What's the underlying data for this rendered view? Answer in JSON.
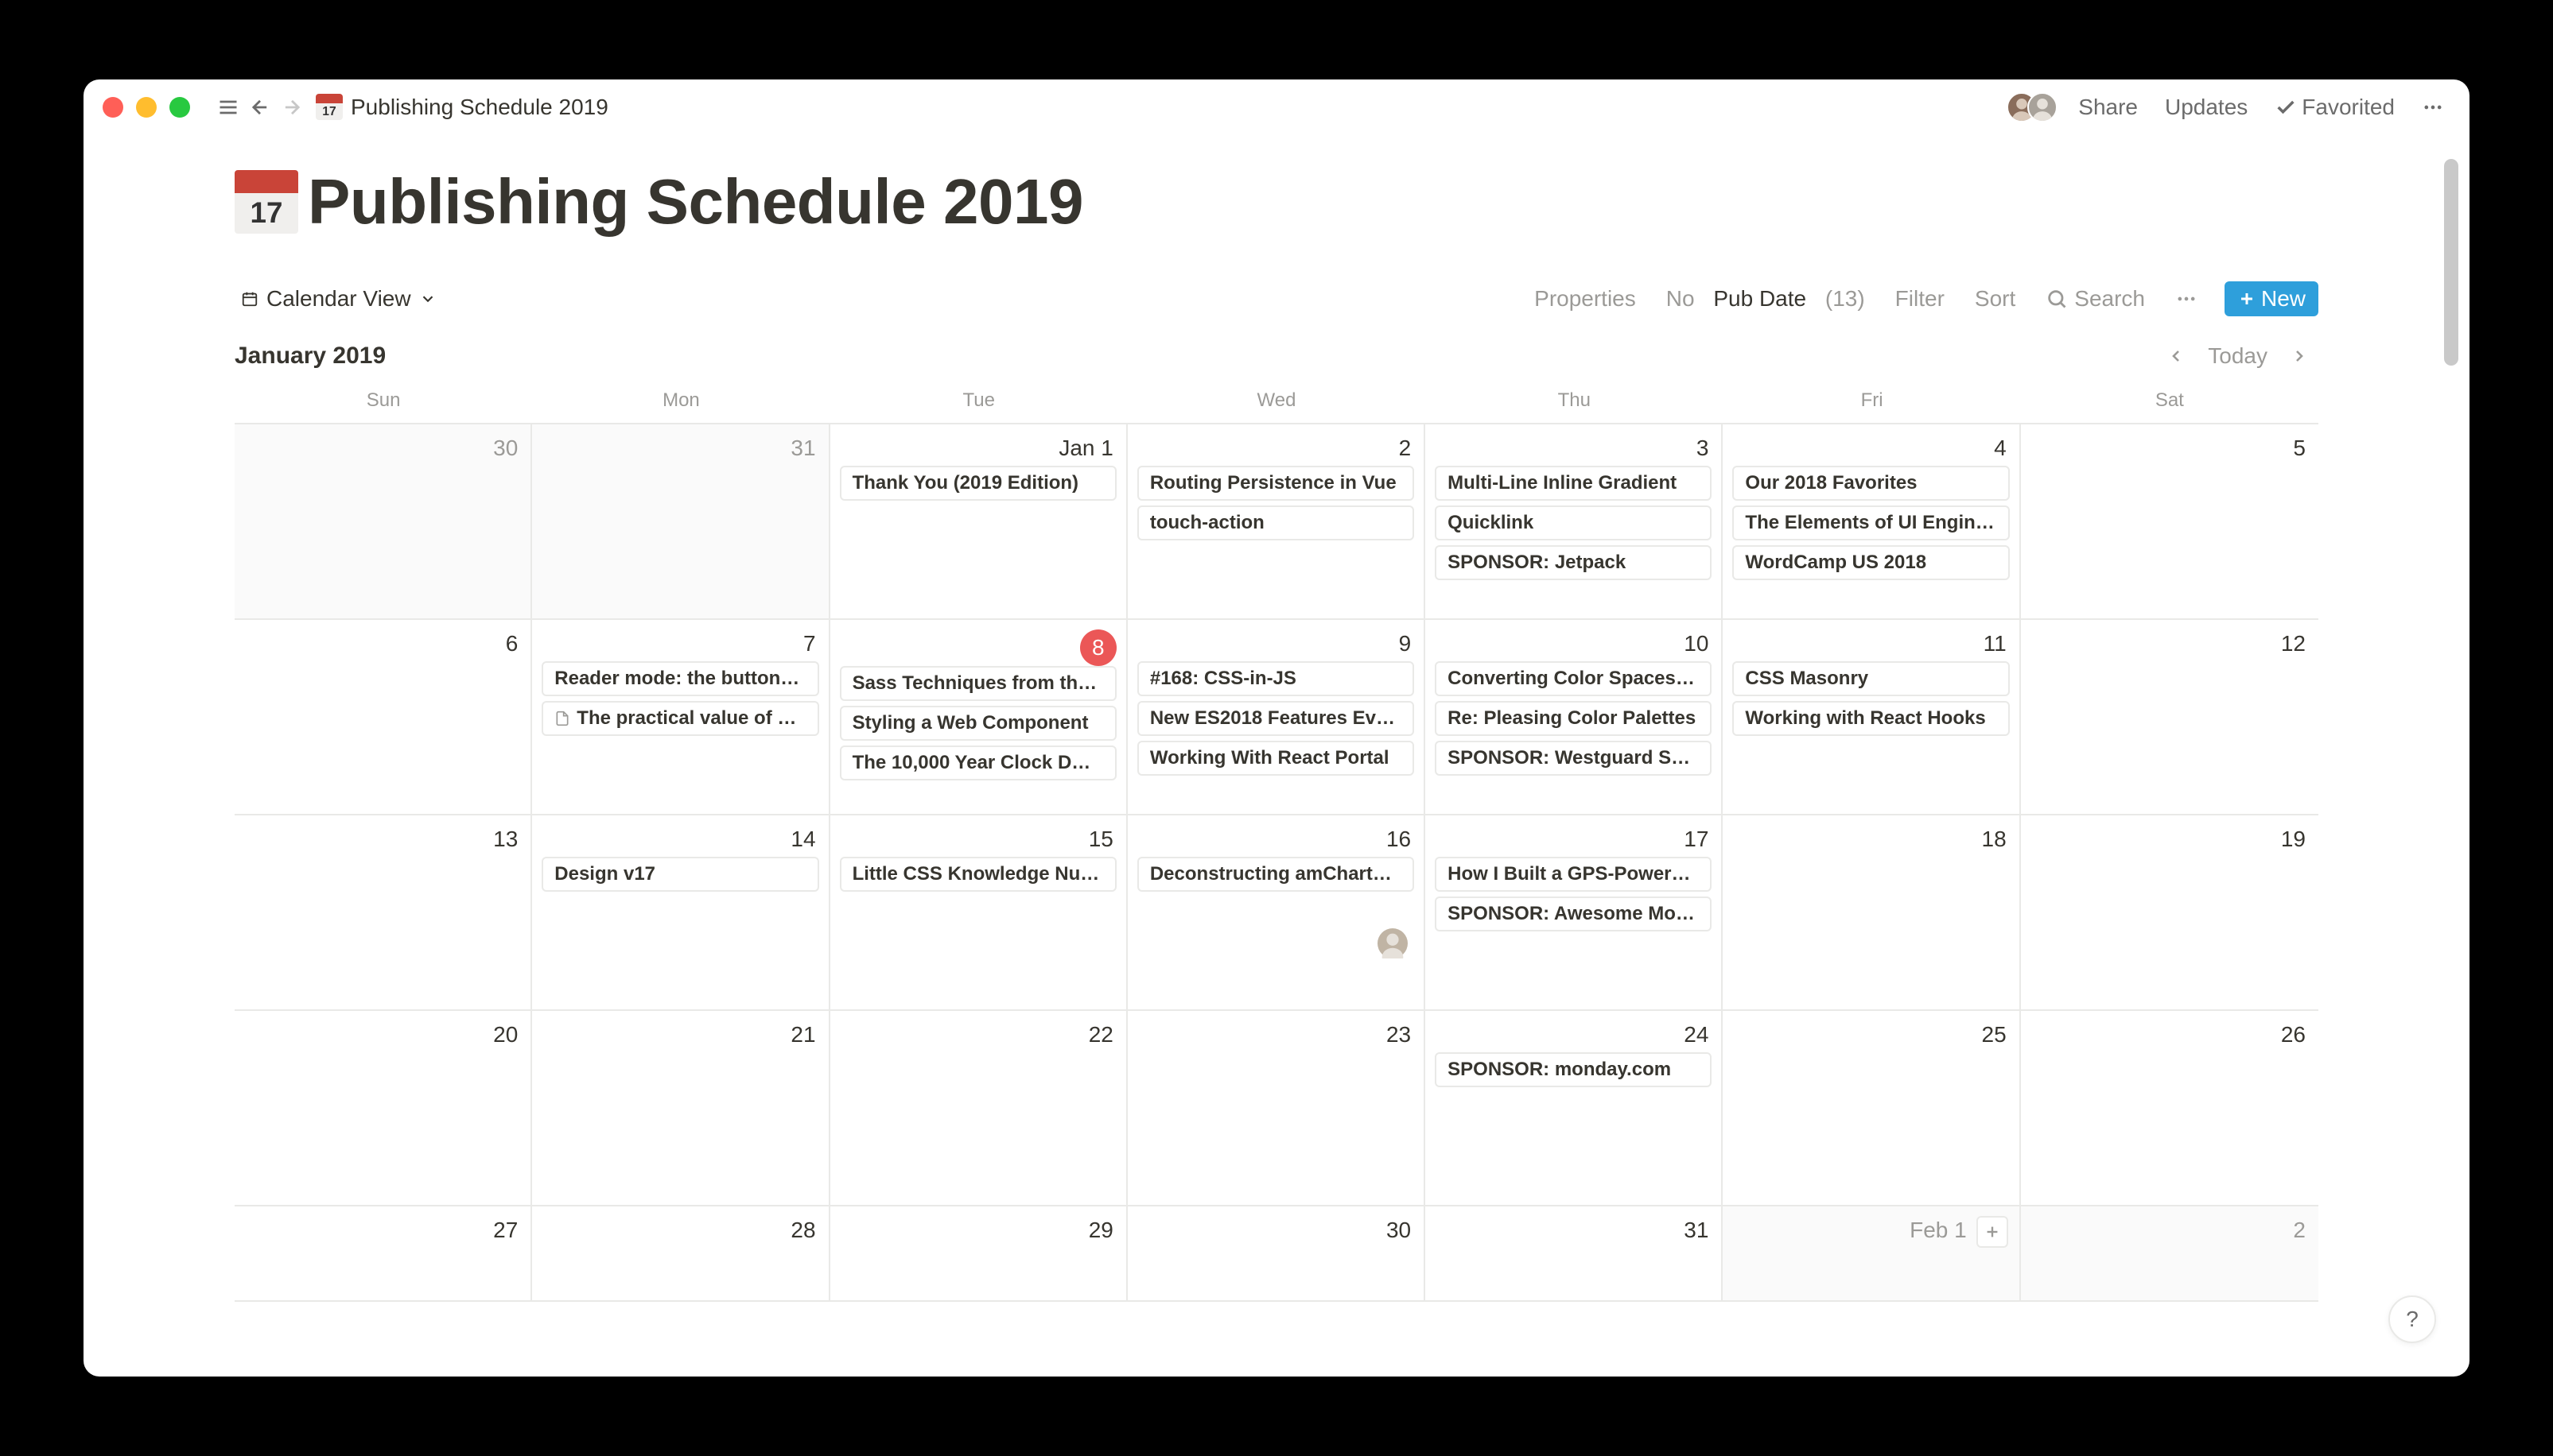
{
  "breadcrumb": {
    "icon_num": "17",
    "title": "Publishing Schedule 2019"
  },
  "titlebar": {
    "share": "Share",
    "updates": "Updates",
    "favorited": "Favorited"
  },
  "page": {
    "icon_num": "17",
    "title": "Publishing Schedule 2019"
  },
  "viewbar": {
    "view_name": "Calendar View",
    "properties": "Properties",
    "filter_prefix": "No",
    "filter_field": "Pub Date",
    "filter_count": "(13)",
    "filter": "Filter",
    "sort": "Sort",
    "search": "Search",
    "new": "New"
  },
  "calendar": {
    "month": "January 2019",
    "today": "Today",
    "day_headers": [
      "Sun",
      "Mon",
      "Tue",
      "Wed",
      "Thu",
      "Fri",
      "Sat"
    ],
    "weeks": [
      [
        {
          "label": "30",
          "other_month": true,
          "events": []
        },
        {
          "label": "31",
          "other_month": true,
          "events": []
        },
        {
          "label": "Jan 1",
          "events": [
            "Thank You (2019 Edition)"
          ]
        },
        {
          "label": "2",
          "events": [
            "Routing Persistence in Vue",
            "touch-action"
          ]
        },
        {
          "label": "3",
          "events": [
            "Multi-Line Inline Gradient",
            "Quicklink",
            "SPONSOR: Jetpack"
          ]
        },
        {
          "label": "4",
          "events": [
            "Our 2018 Favorites",
            "The Elements of UI Engin…",
            "WordCamp US 2018"
          ]
        },
        {
          "label": "5",
          "events": []
        }
      ],
      [
        {
          "label": "6",
          "events": []
        },
        {
          "label": "7",
          "events": [
            "Reader mode: the button…",
            {
              "text": "The practical value of …",
              "doc": true
            }
          ]
        },
        {
          "label": "8",
          "today": true,
          "events": [
            "Sass Techniques from th…",
            "Styling a Web Component",
            "The 10,000 Year Clock D…"
          ]
        },
        {
          "label": "9",
          "events": [
            "#168: CSS-in-JS",
            "New ES2018 Features Ev…",
            "Working With React Portal"
          ]
        },
        {
          "label": "10",
          "events": [
            "Converting Color Spaces…",
            "Re: Pleasing Color Palettes",
            "SPONSOR: Westguard S…"
          ]
        },
        {
          "label": "11",
          "events": [
            "CSS Masonry",
            "Working with React Hooks"
          ]
        },
        {
          "label": "12",
          "events": []
        }
      ],
      [
        {
          "label": "13",
          "events": []
        },
        {
          "label": "14",
          "events": [
            "Design v17"
          ]
        },
        {
          "label": "15",
          "events": [
            "Little CSS Knowledge Nu…"
          ]
        },
        {
          "label": "16",
          "events": [
            "Deconstructing amChart…"
          ],
          "avatar": true
        },
        {
          "label": "17",
          "events": [
            "How I Built a GPS-Power…",
            "SPONSOR: Awesome Mo…"
          ]
        },
        {
          "label": "18",
          "events": []
        },
        {
          "label": "19",
          "events": []
        }
      ],
      [
        {
          "label": "20",
          "events": []
        },
        {
          "label": "21",
          "events": []
        },
        {
          "label": "22",
          "events": []
        },
        {
          "label": "23",
          "events": []
        },
        {
          "label": "24",
          "events": [
            "SPONSOR: monday.com"
          ]
        },
        {
          "label": "25",
          "events": []
        },
        {
          "label": "26",
          "events": []
        }
      ],
      [
        {
          "label": "27",
          "events": []
        },
        {
          "label": "28",
          "events": []
        },
        {
          "label": "29",
          "events": []
        },
        {
          "label": "30",
          "events": []
        },
        {
          "label": "31",
          "events": []
        },
        {
          "label": "Feb 1",
          "other_month": true,
          "events": [],
          "hover_add": true
        },
        {
          "label": "2",
          "other_month": true,
          "events": []
        }
      ]
    ]
  },
  "help": "?"
}
